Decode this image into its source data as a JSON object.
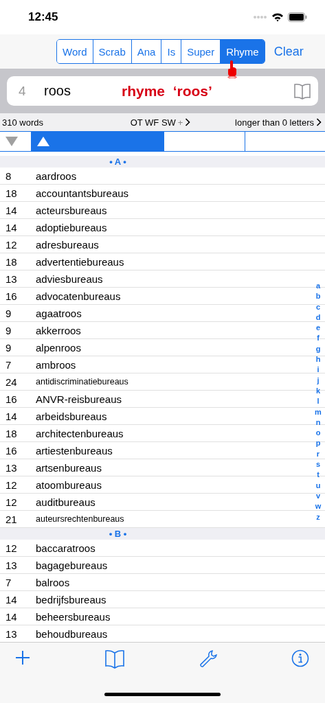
{
  "status_bar": {
    "time": "12:45"
  },
  "modes": [
    {
      "label": "Word",
      "selected": false
    },
    {
      "label": "Scrab",
      "selected": false
    },
    {
      "label": "Ana",
      "selected": false
    },
    {
      "label": "Is",
      "selected": false
    },
    {
      "label": "Super",
      "selected": false
    },
    {
      "label": "Rhyme",
      "selected": true
    }
  ],
  "clear_button": "Clear",
  "search": {
    "count": "4",
    "value": "roos",
    "mode_label": "rhyme  ‘roos’"
  },
  "info_bar": {
    "word_count": "310 words",
    "filters": "OT  WF  SW",
    "plus": "+",
    "length_filter": "longer than 0 letters"
  },
  "sort_columns": [
    {
      "kind": "descending",
      "selected": false
    },
    {
      "kind": "ascending",
      "selected": true
    },
    {
      "kind": "blank",
      "selected": false
    },
    {
      "kind": "blank",
      "selected": false
    }
  ],
  "sections": [
    {
      "title": "• A •",
      "rows": [
        {
          "length": "8",
          "word": "aardroos"
        },
        {
          "length": "18",
          "word": "accountantsbureaus"
        },
        {
          "length": "14",
          "word": "acteursbureaus"
        },
        {
          "length": "14",
          "word": "adoptiebureaus"
        },
        {
          "length": "12",
          "word": "adresbureaus"
        },
        {
          "length": "18",
          "word": "advertentiebureaus"
        },
        {
          "length": "13",
          "word": "adviesbureaus"
        },
        {
          "length": "16",
          "word": "advocatenbureaus"
        },
        {
          "length": "9",
          "word": "agaatroos"
        },
        {
          "length": "9",
          "word": "akkerroos"
        },
        {
          "length": "9",
          "word": "alpenroos"
        },
        {
          "length": "7",
          "word": "ambroos"
        },
        {
          "length": "24",
          "word": "antidiscriminatiebureaus"
        },
        {
          "length": "16",
          "word": "ANVR-reisbureaus"
        },
        {
          "length": "14",
          "word": "arbeidsbureaus"
        },
        {
          "length": "18",
          "word": "architectenbureaus"
        },
        {
          "length": "16",
          "word": "artiestenbureaus"
        },
        {
          "length": "13",
          "word": "artsenbureaus"
        },
        {
          "length": "12",
          "word": "atoombureaus"
        },
        {
          "length": "12",
          "word": "auditbureaus"
        },
        {
          "length": "21",
          "word": "auteursrechtenbureaus"
        }
      ]
    },
    {
      "title": "• B •",
      "rows": [
        {
          "length": "12",
          "word": "baccaratroos"
        },
        {
          "length": "13",
          "word": "bagagebureaus"
        },
        {
          "length": "7",
          "word": "balroos"
        },
        {
          "length": "14",
          "word": "bedrijfsbureaus"
        },
        {
          "length": "14",
          "word": "beheersbureaus"
        },
        {
          "length": "13",
          "word": "behoudbureaus"
        }
      ]
    }
  ],
  "index": [
    "a",
    "b",
    "c",
    "d",
    "e",
    "f",
    "g",
    "h",
    "i",
    "j",
    "k",
    "l",
    "m",
    "n",
    "o",
    "p",
    "r",
    "s",
    "t",
    "u",
    "v",
    "w",
    "z"
  ]
}
